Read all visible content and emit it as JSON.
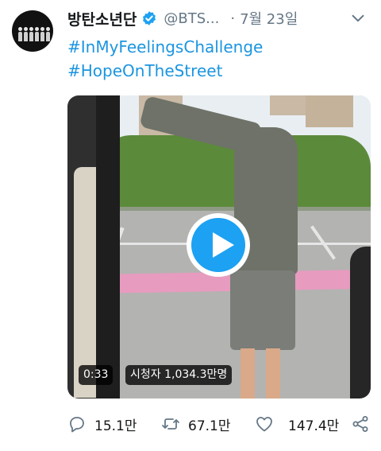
{
  "tweet": {
    "display_name": "방탄소년단",
    "handle": "@BTS...",
    "separator": "·",
    "date": "7월 23일",
    "hashtags": [
      "#InMyFeelingsChallenge",
      "#HopeOnTheStreet"
    ]
  },
  "video": {
    "duration": "0:33",
    "views": "시청자 1,034.3만명"
  },
  "actions": {
    "replies": "15.1만",
    "retweets": "67.1만",
    "likes": "147.4만"
  },
  "colors": {
    "accent": "#1da1f2",
    "link": "#1b95e0",
    "muted": "#657786"
  },
  "icons": [
    "verified-badge-icon",
    "chevron-down-icon",
    "play-icon",
    "reply-icon",
    "retweet-icon",
    "like-icon",
    "share-icon"
  ]
}
